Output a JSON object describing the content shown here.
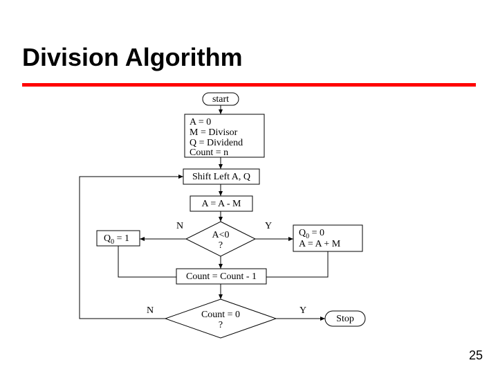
{
  "title": "Division Algorithm",
  "page_number": "25",
  "flow": {
    "start": "start",
    "init_l1": "A = 0",
    "init_l2": "M = Divisor",
    "init_l3": "Q = Dividend",
    "init_l4": "Count = n",
    "shift": "Shift Left A, Q",
    "sub": "A = A - M",
    "dec_a_lt0": "A<0",
    "qmark": "?",
    "no_label": "N",
    "yes_label": "Y",
    "q0_eq_1_a": "Q",
    "q0_eq_1_b": " = 1",
    "q0_eq_0_a": "Q",
    "q0_eq_0_b": " = 0",
    "restore": "A = A + M",
    "count_dec": "Count = Count - 1",
    "dec_count0": "Count = 0",
    "stop": "Stop",
    "sub0": "0"
  },
  "chart_data": {
    "type": "flowchart",
    "nodes": [
      {
        "id": "start",
        "shape": "terminator",
        "label": "start"
      },
      {
        "id": "init",
        "shape": "process",
        "label": "A = 0\nM = Divisor\nQ = Dividend\nCount = n"
      },
      {
        "id": "shift",
        "shape": "process",
        "label": "Shift Left A, Q"
      },
      {
        "id": "sub",
        "shape": "process",
        "label": "A = A - M"
      },
      {
        "id": "decA",
        "shape": "decision",
        "label": "A<0 ?"
      },
      {
        "id": "q1",
        "shape": "process",
        "label": "Q0 = 1"
      },
      {
        "id": "q0restore",
        "shape": "process",
        "label": "Q0 = 0\nA = A + M"
      },
      {
        "id": "countdec",
        "shape": "process",
        "label": "Count = Count - 1"
      },
      {
        "id": "decCount",
        "shape": "decision",
        "label": "Count = 0 ?"
      },
      {
        "id": "stop",
        "shape": "terminator",
        "label": "Stop"
      }
    ],
    "edges": [
      {
        "from": "start",
        "to": "init"
      },
      {
        "from": "init",
        "to": "shift"
      },
      {
        "from": "shift",
        "to": "sub"
      },
      {
        "from": "sub",
        "to": "decA"
      },
      {
        "from": "decA",
        "to": "q1",
        "label": "N"
      },
      {
        "from": "decA",
        "to": "q0restore",
        "label": "Y"
      },
      {
        "from": "q1",
        "to": "countdec"
      },
      {
        "from": "q0restore",
        "to": "countdec"
      },
      {
        "from": "countdec",
        "to": "decCount"
      },
      {
        "from": "decCount",
        "to": "shift",
        "label": "N"
      },
      {
        "from": "decCount",
        "to": "stop",
        "label": "Y"
      }
    ]
  }
}
